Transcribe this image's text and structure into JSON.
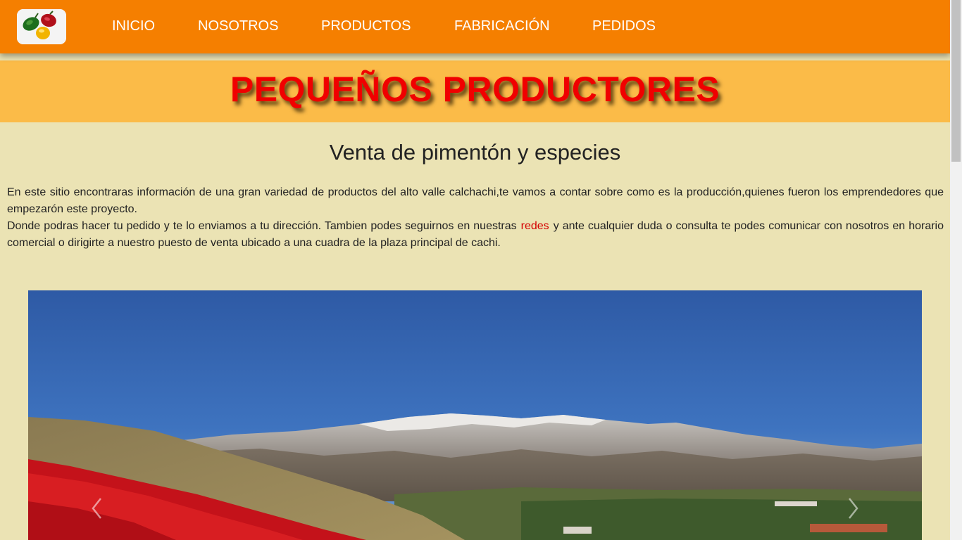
{
  "nav": {
    "logo_icon": "peppers-logo-icon",
    "items": [
      {
        "label": "INICIO"
      },
      {
        "label": "NOSOTROS"
      },
      {
        "label": "PRODUCTOS"
      },
      {
        "label": "FABRICACIÓN"
      },
      {
        "label": "PEDIDOS"
      }
    ]
  },
  "banner": {
    "title": "PEQUEÑOS PRODUCTORES"
  },
  "main": {
    "subtitle": "Venta de pimentón y especies",
    "paragraph1": "En este sitio encontraras información de una gran variedad de productos del alto valle calchachi,te vamos a contar sobre como es la producción,quienes fueron los emprendedores que empezarón este proyecto.",
    "paragraph2_before": "Donde podras hacer tu pedido y te lo enviamos a tu dirección. Tambien podes seguirnos en nuestras",
    "redes_link": "redes",
    "paragraph2_after": "y ante cualquier duda o consulta te podes comunicar con nosotros en horario comercial o dirigirte a nuestro puesto de venta ubicado a una cuadra de la plaza principal de cachi."
  },
  "carousel": {
    "image_icon": "pepper-field-mountains-image",
    "prev_icon": "chevron-left-icon",
    "next_icon": "chevron-right-icon"
  },
  "colors": {
    "navbar": "#f57f00",
    "banner": "#fbbb48",
    "background": "#ebe3b4",
    "title_red": "#f00000",
    "link_red": "#d40000"
  }
}
